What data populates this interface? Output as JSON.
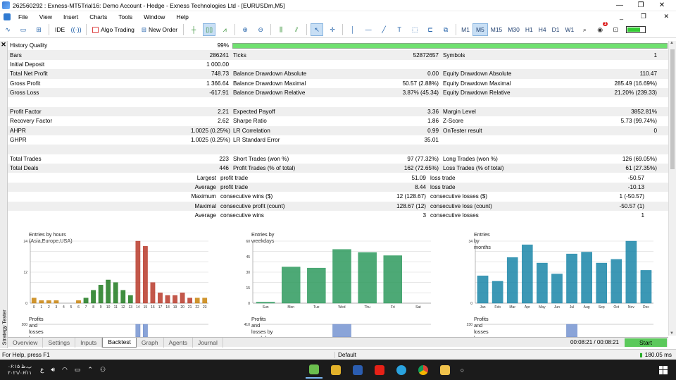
{
  "window": {
    "title": "262560292 : Exness-MT5Trial16: Demo Account - Hedge - Exness Technologies Ltd - [EURUSDm,M5]",
    "min": "—",
    "restore": "❐",
    "close": "✕"
  },
  "menu": [
    "File",
    "View",
    "Insert",
    "Charts",
    "Tools",
    "Window",
    "Help"
  ],
  "menu_ctl": {
    "min": "_",
    "restore": "❐",
    "close": "✕"
  },
  "toolbar": {
    "ide": "IDE",
    "algo": "Algo Trading",
    "neworder": "New Order",
    "timeframes": [
      "M1",
      "M5",
      "M15",
      "M30",
      "H1",
      "H4",
      "D1",
      "W1"
    ],
    "active_tf": "M5",
    "notif": "1"
  },
  "report": {
    "hq": {
      "label": "History Quality",
      "value": "99%"
    },
    "rows": [
      {
        "a": "Bars",
        "b": "286241",
        "c": "Ticks",
        "d": "52872657",
        "e": "Symbols",
        "f": "1"
      },
      {
        "a": "Initial Deposit",
        "b": "1 000.00",
        "c": "",
        "d": "",
        "e": "",
        "f": ""
      },
      {
        "a": "Total Net Profit",
        "b": "748.73",
        "c": "Balance Drawdown Absolute",
        "d": "0.00",
        "e": "Equity Drawdown Absolute",
        "f": "110.47"
      },
      {
        "a": "Gross Profit",
        "b": "1 366.64",
        "c": "Balance Drawdown Maximal",
        "d": "50.57 (2.88%)",
        "e": "Equity Drawdown Maximal",
        "f": "285.49 (16.69%)"
      },
      {
        "a": "Gross Loss",
        "b": "-617.91",
        "c": "Balance Drawdown Relative",
        "d": "3.87% (45.34)",
        "e": "Equity Drawdown Relative",
        "f": "21.20% (239.33)"
      },
      {
        "a": "",
        "b": "",
        "c": "",
        "d": "",
        "e": "",
        "f": ""
      },
      {
        "a": "Profit Factor",
        "b": "2.21",
        "c": "Expected Payoff",
        "d": "3.36",
        "e": "Margin Level",
        "f": "3852.81%"
      },
      {
        "a": "Recovery Factor",
        "b": "2.62",
        "c": "Sharpe Ratio",
        "d": "1.86",
        "e": "Z-Score",
        "f": "5.73 (99.74%)"
      },
      {
        "a": "AHPR",
        "b": "1.0025 (0.25%)",
        "c": "LR Correlation",
        "d": "0.99",
        "e": "OnTester result",
        "f": "0"
      },
      {
        "a": "GHPR",
        "b": "1.0025 (0.25%)",
        "c": "LR Standard Error",
        "d": "35.01",
        "e": "",
        "f": ""
      },
      {
        "a": "",
        "b": "",
        "c": "",
        "d": "",
        "e": "",
        "f": ""
      },
      {
        "a": "Total Trades",
        "b": "223",
        "c": "Short Trades (won %)",
        "d": "97 (77.32%)",
        "e": "Long Trades (won %)",
        "f": "126 (69.05%)"
      },
      {
        "a": "Total Deals",
        "b": "446",
        "c": "Profit Trades (% of total)",
        "d": "162 (72.65%)",
        "e": "Loss Trades (% of total)",
        "f": "61 (27.35%)"
      }
    ],
    "rrows": [
      {
        "a": "Largest",
        "c": "profit trade",
        "d": "51.09",
        "e": "loss trade",
        "f": "-50.57"
      },
      {
        "a": "Average",
        "c": "profit trade",
        "d": "8.44",
        "e": "loss trade",
        "f": "-10.13"
      },
      {
        "a": "Maximum",
        "c": "consecutive wins ($)",
        "d": "12 (128.67)",
        "e": "consecutive losses ($)",
        "f": "1 (-50.57)"
      },
      {
        "a": "Maximal",
        "c": "consecutive profit (count)",
        "d": "128.67 (12)",
        "e": "consecutive loss (count)",
        "f": "-50.57 (1)"
      },
      {
        "a": "Average",
        "c": "consecutive wins",
        "d": "3",
        "e": "consecutive losses",
        "f": "1"
      }
    ]
  },
  "chart_data": [
    {
      "type": "bar",
      "title": "Entries by hours (Asia,Europe,USA)",
      "categories": [
        "0",
        "1",
        "2",
        "3",
        "4",
        "5",
        "6",
        "7",
        "8",
        "9",
        "10",
        "11",
        "12",
        "13",
        "14",
        "15",
        "16",
        "17",
        "18",
        "19",
        "20",
        "21",
        "22",
        "23"
      ],
      "values": [
        2,
        1,
        1,
        1,
        0,
        0,
        1,
        2,
        5,
        7,
        9,
        8,
        5,
        3,
        24,
        22,
        8,
        4,
        3,
        3,
        4,
        2,
        2,
        2
      ],
      "ylim": [
        0,
        24
      ],
      "yticks": [
        "0",
        "12",
        "24"
      ],
      "colors": [
        "#c8820a",
        "#c8820a",
        "#c8820a",
        "#c8820a",
        "#c8820a",
        "#c8820a",
        "#c8820a",
        "#1e7a1e",
        "#1e7a1e",
        "#1e7a1e",
        "#1e7a1e",
        "#1e7a1e",
        "#1e7a1e",
        "#1e7a1e",
        "#b83a2a",
        "#b83a2a",
        "#b83a2a",
        "#b83a2a",
        "#b83a2a",
        "#b83a2a",
        "#b83a2a",
        "#b83a2a",
        "#c8820a",
        "#c8820a"
      ],
      "subtitle": "Profits and losses by hours",
      "sub_tick": "200"
    },
    {
      "type": "bar",
      "title": "Entries by weekdays",
      "categories": [
        "Sun",
        "Mon",
        "Tue",
        "Wed",
        "Thu",
        "Fri",
        "Sat"
      ],
      "values": [
        1,
        35,
        34,
        52,
        49,
        46,
        0
      ],
      "ylim": [
        0,
        60
      ],
      "yticks": [
        "0",
        "15",
        "30",
        "45",
        "60"
      ],
      "colors": [
        "#2e9a5e",
        "#2e9a5e",
        "#2e9a5e",
        "#2e9a5e",
        "#2e9a5e",
        "#2e9a5e",
        "#2e9a5e"
      ],
      "subtitle": "Profits and losses by weekdays",
      "sub_tick": "410"
    },
    {
      "type": "bar",
      "title": "Entries by months",
      "categories": [
        "Jan",
        "Feb",
        "Mar",
        "Apr",
        "May",
        "Jun",
        "Jul",
        "Aug",
        "Sep",
        "Oct",
        "Nov",
        "Dec"
      ],
      "values": [
        15,
        12,
        25,
        32,
        22,
        16,
        27,
        28,
        22,
        24,
        34,
        18
      ],
      "ylim": [
        0,
        34
      ],
      "yticks": [
        "0",
        "34"
      ],
      "colors": [
        "#1a86a8",
        "#1a86a8",
        "#1a86a8",
        "#1a86a8",
        "#1a86a8",
        "#1a86a8",
        "#1a86a8",
        "#1a86a8",
        "#1a86a8",
        "#1a86a8",
        "#1a86a8",
        "#1a86a8"
      ],
      "subtitle": "Profits and losses by months",
      "sub_tick": "230"
    }
  ],
  "side": {
    "close": "✕",
    "label": "Strategy Tester"
  },
  "tabs": [
    "Overview",
    "Settings",
    "Inputs",
    "Backtest",
    "Graph",
    "Agents",
    "Journal"
  ],
  "active_tab": "Backtest",
  "timer": "00:08:21 / 00:08:21",
  "start": "Start",
  "status": {
    "help": "For Help, press F1",
    "profile": "Default",
    "ping": "180.05 ms"
  },
  "taskbar": {
    "clock1": "۰۶:۱۵ ب.ظ",
    "clock2": "۲۰۲۱/۰۶/۱۱",
    "lang": "ع"
  }
}
